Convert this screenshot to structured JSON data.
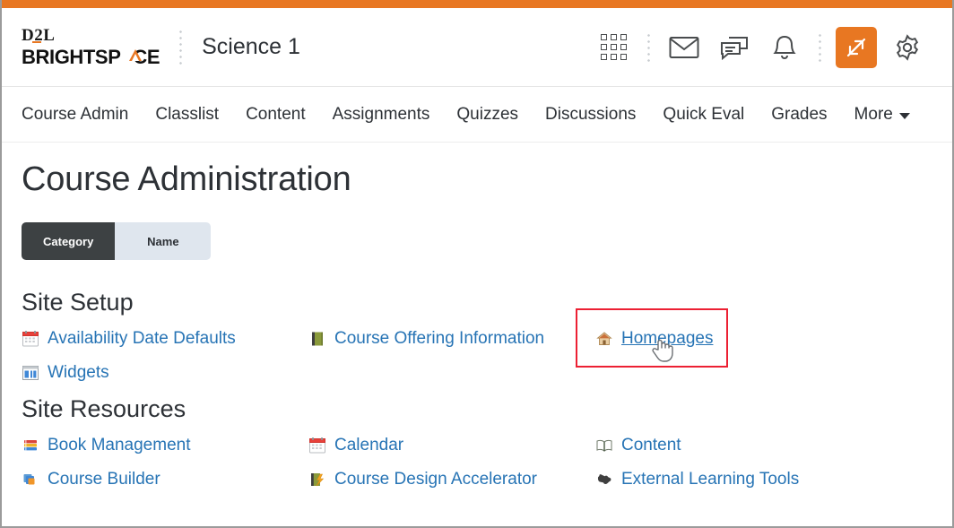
{
  "brand": {
    "logo_top": "D2L",
    "logo_bottom": "BRIGHTSP",
    "logo_bottom_tail": "CE",
    "accent_color": "#E87722"
  },
  "header": {
    "course_title": "Science 1",
    "icons": [
      {
        "name": "waffle-menu-icon",
        "label": "Course Selector"
      },
      {
        "name": "envelope-icon",
        "label": "Message Alerts"
      },
      {
        "name": "chat-bubbles-icon",
        "label": "Subscription Alerts"
      },
      {
        "name": "bell-icon",
        "label": "Update Alerts"
      },
      {
        "name": "diagonal-arrows-icon",
        "label": "Switch View"
      },
      {
        "name": "gear-icon",
        "label": "Settings"
      }
    ]
  },
  "nav": {
    "items": [
      {
        "label": "Course Admin"
      },
      {
        "label": "Classlist"
      },
      {
        "label": "Content"
      },
      {
        "label": "Assignments"
      },
      {
        "label": "Quizzes"
      },
      {
        "label": "Discussions"
      },
      {
        "label": "Quick Eval"
      },
      {
        "label": "Grades"
      }
    ],
    "more_label": "More"
  },
  "main": {
    "page_title": "Course Administration",
    "toggle": {
      "category_label": "Category",
      "name_label": "Name",
      "selected": "Category"
    },
    "sections": [
      {
        "title": "Site Setup",
        "items": [
          {
            "label": "Availability Date Defaults",
            "icon": "calendar-icon",
            "highlighted": false
          },
          {
            "label": "Course Offering Information",
            "icon": "book-closed-icon",
            "highlighted": false
          },
          {
            "label": "Homepages",
            "icon": "house-icon",
            "highlighted": true
          },
          {
            "label": "Widgets",
            "icon": "widgets-icon",
            "highlighted": false
          }
        ]
      },
      {
        "title": "Site Resources",
        "items": [
          {
            "label": "Book Management",
            "icon": "books-stack-icon",
            "highlighted": false
          },
          {
            "label": "Calendar",
            "icon": "calendar-icon",
            "highlighted": false
          },
          {
            "label": "Content",
            "icon": "open-book-icon",
            "highlighted": false
          },
          {
            "label": "Course Builder",
            "icon": "layers-icon",
            "highlighted": false
          },
          {
            "label": "Course Design Accelerator",
            "icon": "book-lightning-icon",
            "highlighted": false
          },
          {
            "label": "External Learning Tools",
            "icon": "puzzle-icon",
            "highlighted": false
          }
        ]
      }
    ],
    "highlight_color": "#ec2033",
    "link_color": "#2774b5"
  }
}
